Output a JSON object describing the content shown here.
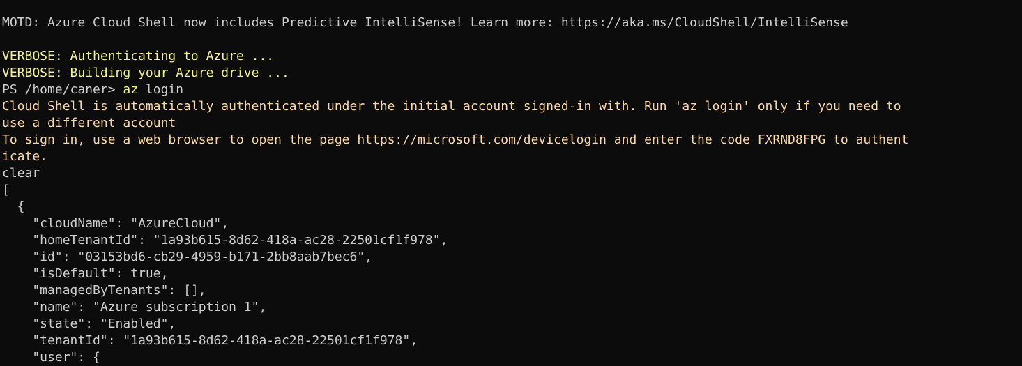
{
  "terminal": {
    "motd": "MOTD: Azure Cloud Shell now includes Predictive IntelliSense! Learn more: https://aka.ms/CloudShell/IntelliSense",
    "verbose_auth": "VERBOSE: Authenticating to Azure ...",
    "verbose_drive": "VERBOSE: Building your Azure drive ...",
    "prompt": "PS /home/caner> ",
    "command_name": "az",
    "command_args": " login",
    "notice_line_1": "Cloud Shell is automatically authenticated under the initial account signed-in with. Run 'az login' only if you need to",
    "notice_line_2": "use a different account",
    "signin_line_1": "To sign in, use a web browser to open the page https://microsoft.com/devicelogin and enter the code FXRND8FPG to authent",
    "signin_line_2": "icate.",
    "typed_clear": "clear",
    "json_lines": [
      "[",
      "  {",
      "    \"cloudName\": \"AzureCloud\",",
      "    \"homeTenantId\": \"1a93b615-8d62-418a-ac28-22501cf1f978\",",
      "    \"id\": \"03153bd6-cb29-4959-b171-2bb8aab7bec6\",",
      "    \"isDefault\": true,",
      "    \"managedByTenants\": [],",
      "    \"name\": \"Azure subscription 1\",",
      "    \"state\": \"Enabled\",",
      "    \"tenantId\": \"1a93b615-8d62-418a-ac28-22501cf1f978\",",
      "    \"user\": {"
    ]
  },
  "colors": {
    "background": "#0c0c0c",
    "default_text": "#cccccc",
    "verbose_text": "#f2f18c",
    "warning_text": "#f8d6a6"
  }
}
